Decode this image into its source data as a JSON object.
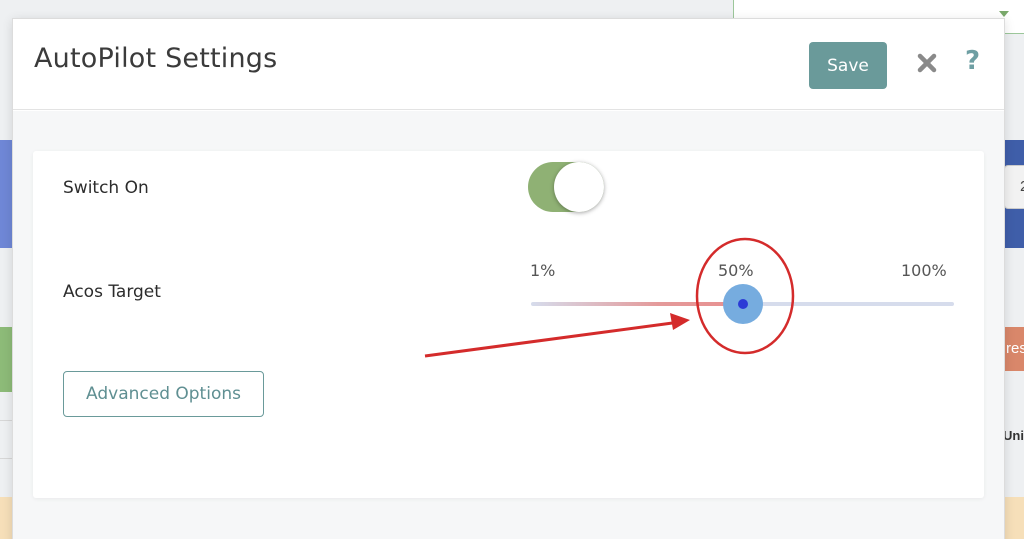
{
  "background": {
    "right_box_text": "2",
    "right_orange_text": "res",
    "right_text": "Uni"
  },
  "modal": {
    "title": "AutoPilot Settings",
    "save_label": "Save",
    "close_icon": "close-icon",
    "help_symbol": "?"
  },
  "settings": {
    "switch_label": "Switch On",
    "switch_on": true,
    "acos_label": "Acos Target",
    "slider": {
      "min_label": "1%",
      "mid_label": "50%",
      "max_label": "100%",
      "value_percent": 50
    },
    "advanced_label": "Advanced Options"
  },
  "colors": {
    "accent": "#6a9a9a",
    "toggle_on": "#8fb174",
    "slider_thumb": "#76acdf",
    "annotation_red": "#d42b2b"
  }
}
